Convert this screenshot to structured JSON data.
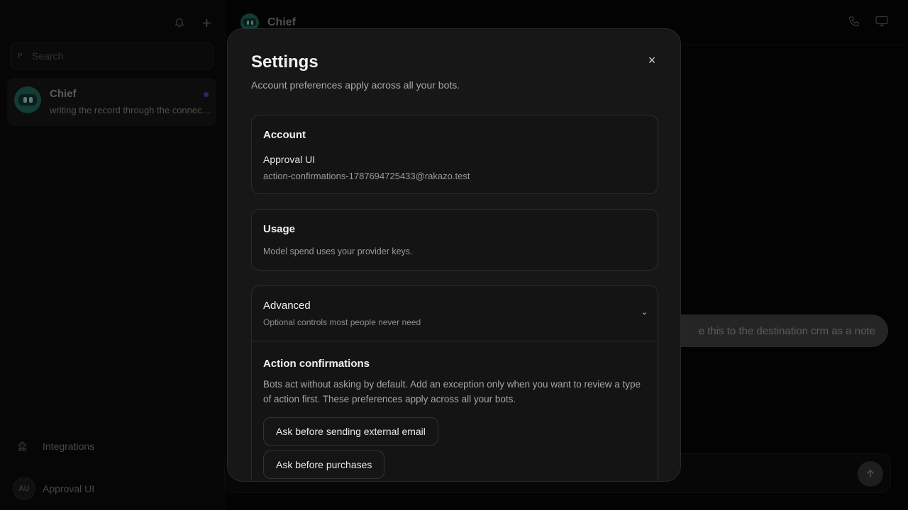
{
  "sidebar": {
    "search_placeholder": "Search",
    "search_shortcut": "P",
    "chats": [
      {
        "name": "Chief",
        "preview": "writing the record through the connector",
        "unread": true
      }
    ],
    "integrations_label": "Integrations",
    "user": {
      "initials": "AU",
      "name": "Approval UI"
    }
  },
  "main": {
    "header_title": "Chief",
    "message_bubble": "e this to the destination crm as a note"
  },
  "modal": {
    "title": "Settings",
    "subtitle": "Account preferences apply across all your bots.",
    "close_glyph": "×",
    "account": {
      "title": "Account",
      "name": "Approval UI",
      "email": "action-confirmations-1787694725433@rakazo.test"
    },
    "usage": {
      "title": "Usage",
      "note": "Model spend uses your provider keys."
    },
    "advanced": {
      "title": "Advanced",
      "subtitle": "Optional controls most people never need",
      "chevron": "⌄",
      "action_confirmations": {
        "title": "Action confirmations",
        "description": "Bots act without asking by default. Add an exception only when you want to review a type of action first. These preferences apply across all your bots.",
        "options": [
          "Ask before sending external email",
          "Ask before purchases"
        ]
      }
    }
  },
  "colors": {
    "modal_bg": "#171717",
    "accent_unread": "#4b3aa8",
    "avatar_teal": "#1d5c52"
  }
}
